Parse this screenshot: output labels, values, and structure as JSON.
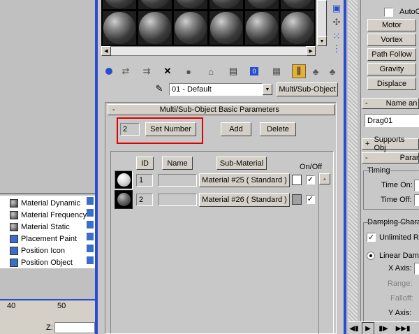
{
  "colors": {
    "viewport_bg": "#c0c0c0",
    "panel_bg": "#c8c8c8",
    "accent_blue": "#2a4cd0",
    "highlight_red": "#e00000"
  },
  "left_list": {
    "items": [
      {
        "label": "Material Dynamic",
        "icon": "sphere-icon"
      },
      {
        "label": "Material Frequency",
        "icon": "sphere-icon"
      },
      {
        "label": "Material Static",
        "icon": "sphere-icon"
      },
      {
        "label": "Placement Paint",
        "icon": "paint-icon"
      },
      {
        "label": "Position Icon",
        "icon": "icon-icon"
      },
      {
        "label": "Position Object",
        "icon": "object-icon"
      }
    ]
  },
  "timeline": {
    "tick_40": "40",
    "tick_50": "50",
    "z_label": "Z:"
  },
  "material_editor": {
    "material_name": "01 - Default",
    "material_type": "Multi/Sub-Object",
    "rollout_title": "Multi/Sub-Object Basic Parameters",
    "rollout_toggle": "-",
    "count_value": "2",
    "set_number_label": "Set Number",
    "add_label": "Add",
    "delete_label": "Delete",
    "col_id": "ID",
    "col_name": "Name",
    "col_submaterial": "Sub-Material",
    "col_onoff": "On/Off",
    "rows": [
      {
        "id": "1",
        "name": "",
        "submaterial": "Material #25  ( Standard )",
        "swatch": "#ffffff",
        "on": "✓"
      },
      {
        "id": "2",
        "name": "",
        "submaterial": "Material #26  ( Standard )",
        "swatch": "#a0a0a0",
        "on": "✓"
      }
    ]
  },
  "command_panel": {
    "auto_label": "AutoO",
    "buttons": [
      "Motor",
      "Vortex",
      "Path Follow",
      "Gravity",
      "Displace"
    ],
    "name_rollout": "Name an",
    "name_toggle": "-",
    "object_name": "Drag01",
    "supports_rollout": "Supports Obj",
    "supports_toggle": "+",
    "param_rollout": "Param",
    "param_toggle": "-",
    "timing_label": "Timing",
    "time_on_label": "Time On:",
    "time_off_label": "Time Off:",
    "damping_label": "Damping Chara",
    "unlimited_label": "Unlimited Ra",
    "linear_label": "Linear Damp",
    "x_axis_label": "X Axis:",
    "range_label": "Range:",
    "falloff_label": "Falloff:",
    "y_axis_label": "Y Axis:"
  }
}
